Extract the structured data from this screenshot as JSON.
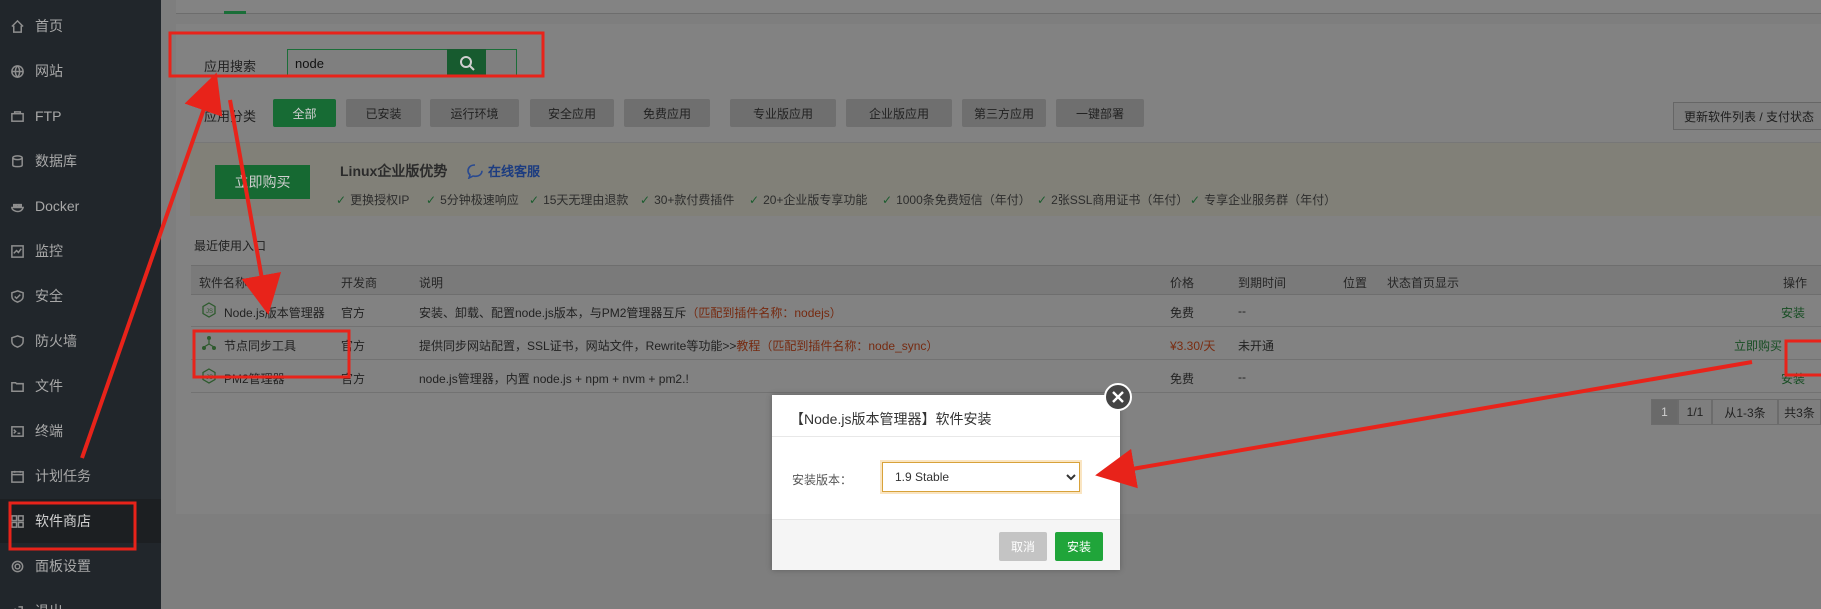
{
  "sidebar": {
    "items": [
      {
        "label": "首页",
        "icon": "home-icon"
      },
      {
        "label": "网站",
        "icon": "globe-icon"
      },
      {
        "label": "FTP",
        "icon": "ftp-icon"
      },
      {
        "label": "数据库",
        "icon": "database-icon"
      },
      {
        "label": "Docker",
        "icon": "docker-icon"
      },
      {
        "label": "监控",
        "icon": "monitor-icon"
      },
      {
        "label": "安全",
        "icon": "shield-icon"
      },
      {
        "label": "防火墙",
        "icon": "firewall-icon"
      },
      {
        "label": "文件",
        "icon": "folder-icon"
      },
      {
        "label": "终端",
        "icon": "terminal-icon"
      },
      {
        "label": "计划任务",
        "icon": "calendar-icon"
      },
      {
        "label": "软件商店",
        "icon": "grid-icon"
      },
      {
        "label": "面板设置",
        "icon": "gear-icon"
      },
      {
        "label": "退出",
        "icon": "logout-icon"
      }
    ],
    "active_index": 11
  },
  "search": {
    "label": "应用搜索",
    "value": "node"
  },
  "category": {
    "label": "应用分类",
    "items": [
      "全部",
      "已安装",
      "运行环境",
      "安全应用",
      "免费应用",
      "专业版应用",
      "企业版应用",
      "第三方应用",
      "一键部署"
    ],
    "active_index": 0,
    "update_label": "更新软件列表 / 支付状态"
  },
  "banner": {
    "buy_label": "立即购买",
    "title": "Linux企业版优势",
    "service": "在线客服",
    "features": [
      "更换授权IP",
      "5分钟极速响应",
      "15天无理由退款",
      "30+款付费插件",
      "20+企业版专享功能",
      "1000条免费短信（年付）",
      "2张SSL商用证书（年付）",
      "专享企业服务群（年付）"
    ]
  },
  "recent_label": "最近使用入口",
  "table": {
    "headers": [
      "软件名称",
      "开发商",
      "说明",
      "价格",
      "到期时间",
      "位置",
      "状态",
      "首页显示",
      "操作"
    ],
    "rows": [
      {
        "name": "Node.js版本管理器",
        "dev": "官方",
        "desc": "安装、卸载、配置node.js版本，与PM2管理器互斥",
        "hint": "（匹配到插件名称：nodejs）",
        "price": "免费",
        "expire": "--",
        "action": "安装"
      },
      {
        "name": "节点同步工具",
        "dev": "官方",
        "desc": "提供同步网站配置，SSL证书，网站文件，Rewrite等功能>>",
        "hint": "教程（匹配到插件名称：node_sync）",
        "price": "¥3.30/天",
        "expire": "未开通",
        "action": "立即购买"
      },
      {
        "name": "PM2管理器",
        "dev": "官方",
        "desc": "node.js管理器，内置 node.js + npm + nvm + pm2.!",
        "hint": "",
        "price": "免费",
        "expire": "--",
        "action": "安装"
      }
    ]
  },
  "pager": {
    "current": "1",
    "pages": "1/1",
    "range": "从1-3条",
    "total": "共3条"
  },
  "modal": {
    "title": "【Node.js版本管理器】软件安装",
    "version_label": "安装版本：",
    "version_value": "1.9 Stable",
    "cancel": "取消",
    "confirm": "安装"
  }
}
